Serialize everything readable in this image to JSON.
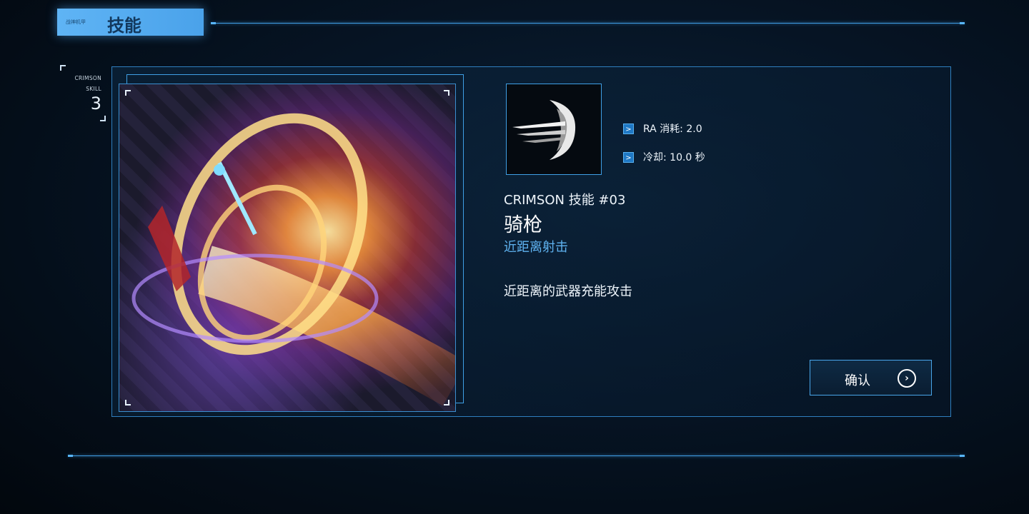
{
  "header": {
    "small_label": "战神机甲",
    "title": "技能"
  },
  "side": {
    "line1": "CRIMSON",
    "line2": "SKILL",
    "number": "3"
  },
  "skill": {
    "icon": "lance-slash-icon",
    "stats": [
      {
        "icon": "chevron-right-icon",
        "text": "RA 消耗: 2.0"
      },
      {
        "icon": "chevron-right-icon",
        "text": "冷却: 10.0 秒"
      }
    ],
    "code": "CRIMSON 技能 #03",
    "name": "骑枪",
    "type": "近距离射击",
    "description": "近距离的武器充能攻击"
  },
  "confirm": {
    "label": "确认",
    "icon": "chevron-circle-right-icon",
    "icon_glyph": "›"
  },
  "colors": {
    "accent": "#4aa2ea",
    "border": "#2f7fbf",
    "type_text": "#5fb2f0"
  }
}
